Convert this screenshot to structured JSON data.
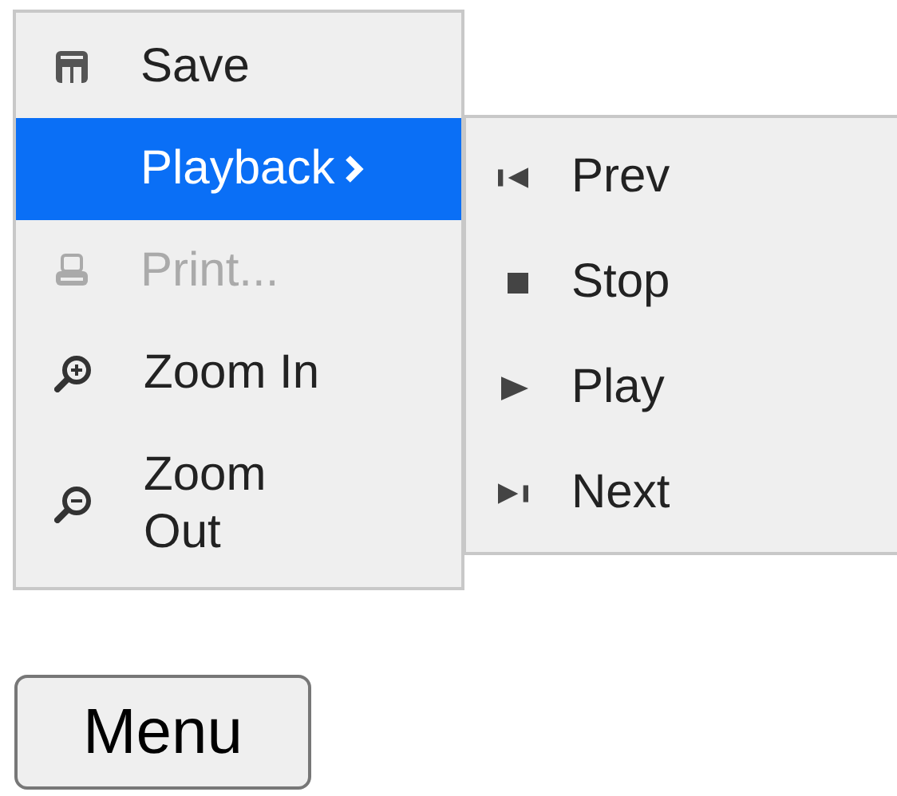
{
  "menu": {
    "items": [
      {
        "kind": "save",
        "label": "Save",
        "selected": false,
        "disabled": false
      },
      {
        "kind": "submenu",
        "label": "Playback",
        "selected": true,
        "disabled": false
      },
      {
        "kind": "print",
        "label": "Print...",
        "selected": false,
        "disabled": true
      },
      {
        "kind": "zoomin",
        "label": "Zoom In",
        "selected": false,
        "disabled": false
      },
      {
        "kind": "zoomout",
        "label": "Zoom Out",
        "selected": false,
        "disabled": false
      }
    ]
  },
  "submenu": {
    "items": [
      {
        "kind": "prev",
        "label": "Prev"
      },
      {
        "kind": "stop",
        "label": "Stop"
      },
      {
        "kind": "play",
        "label": "Play"
      },
      {
        "kind": "next",
        "label": "Next"
      }
    ]
  },
  "button": {
    "label": "Menu"
  }
}
